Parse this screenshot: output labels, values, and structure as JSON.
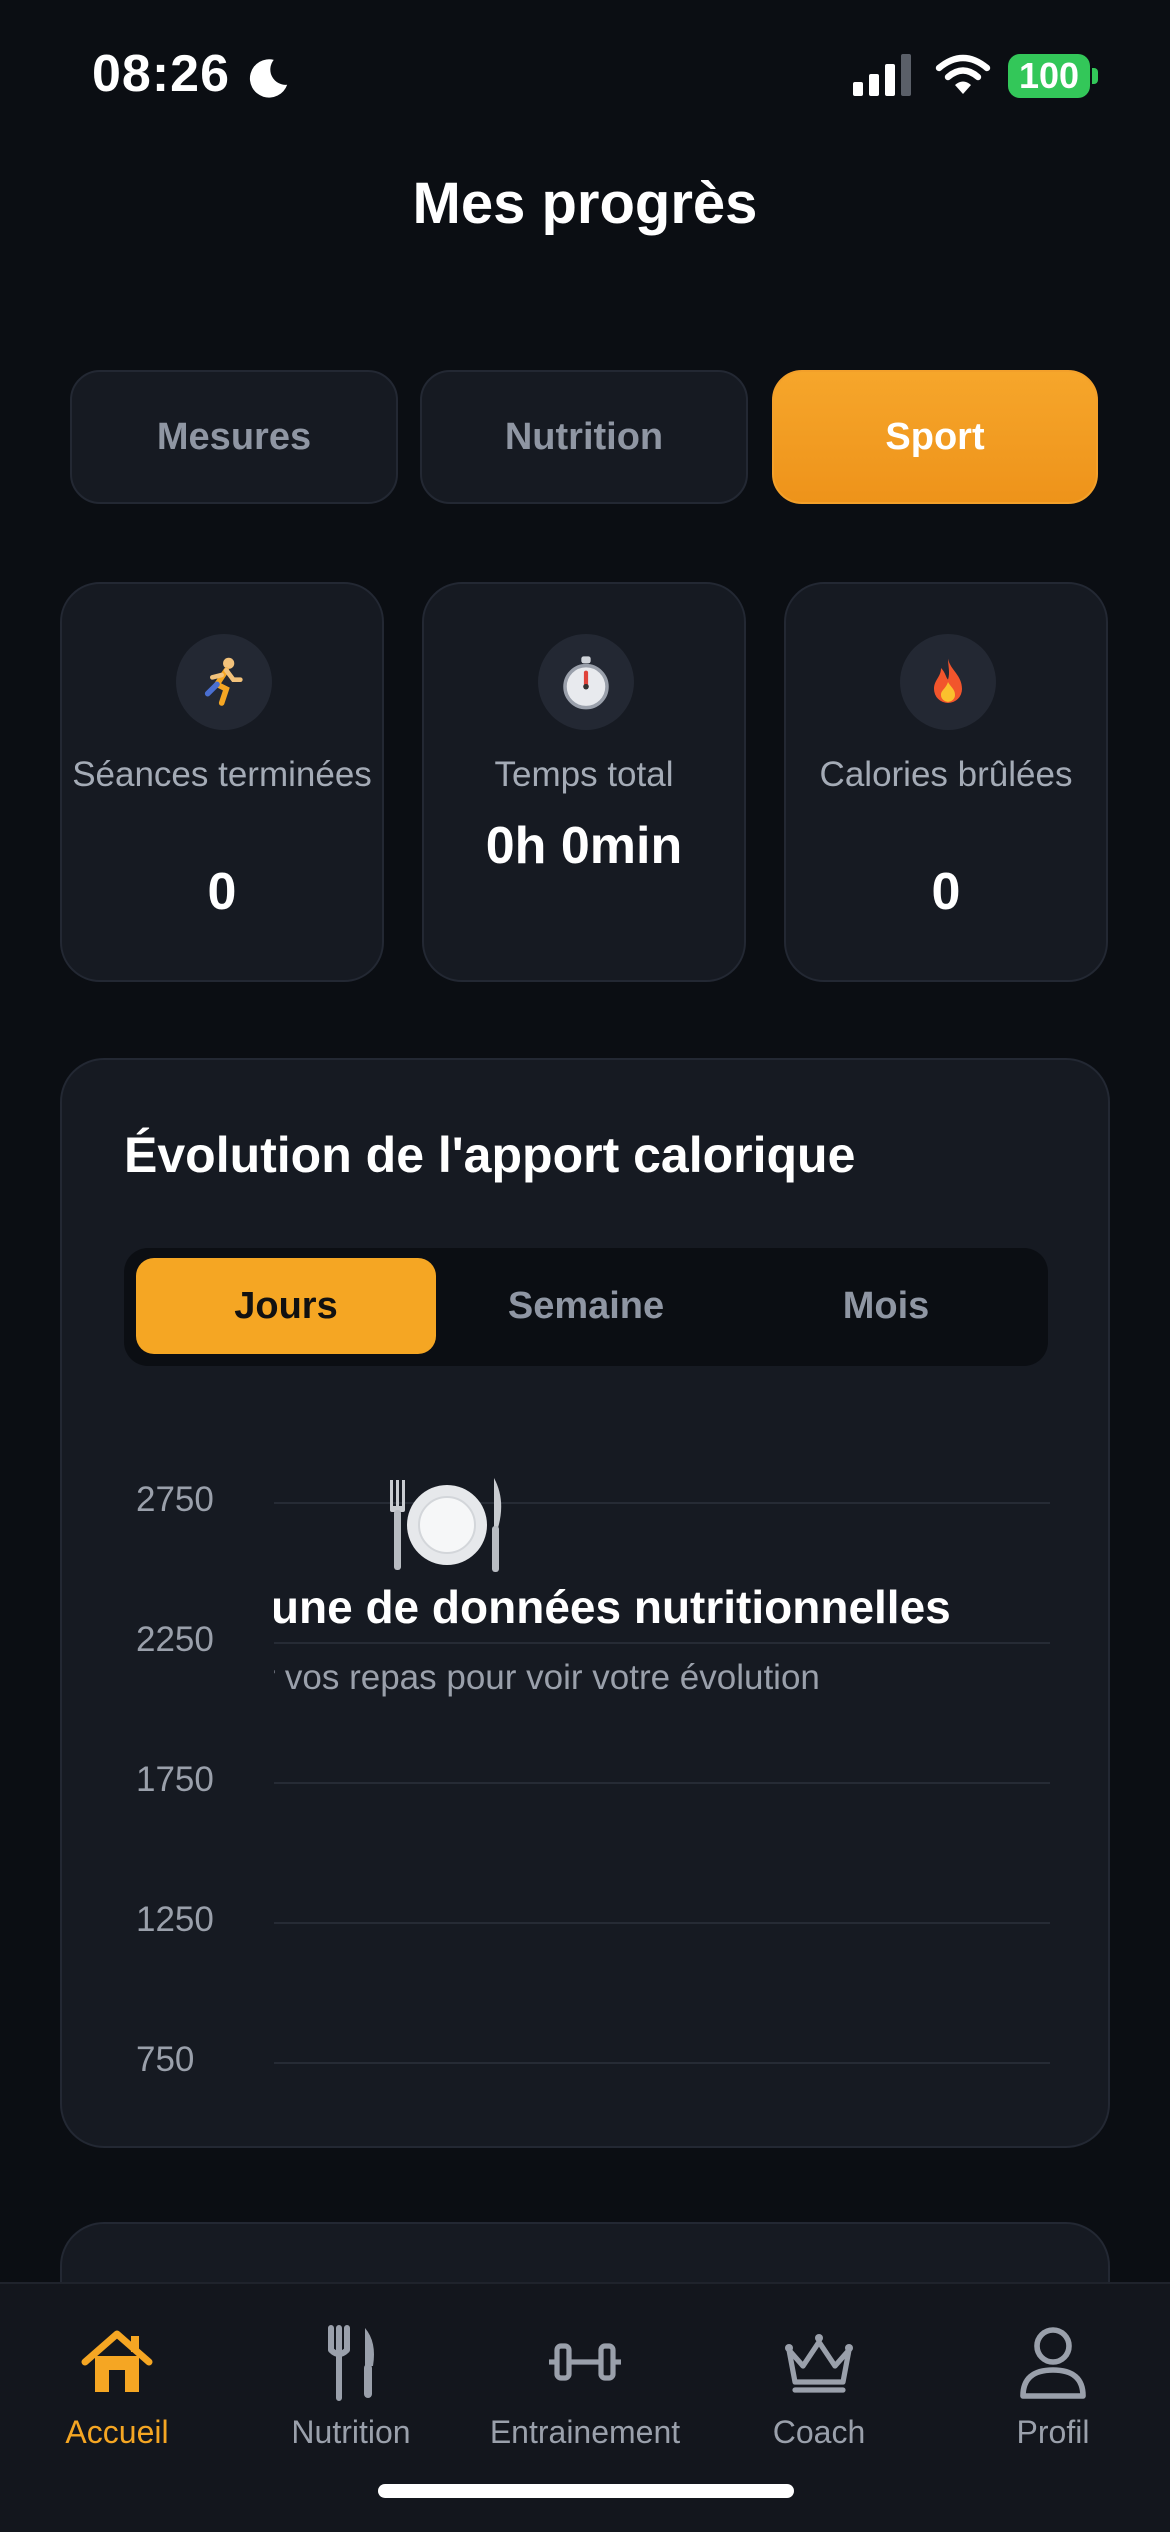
{
  "status": {
    "time": "08:26",
    "battery": "100"
  },
  "header": {
    "title": "Mes progrès"
  },
  "tabs": [
    {
      "label": "Mesures",
      "active": false
    },
    {
      "label": "Nutrition",
      "active": false
    },
    {
      "label": "Sport",
      "active": true
    }
  ],
  "stats": [
    {
      "label": "Séances terminées",
      "value": "0",
      "icon": "runner-icon"
    },
    {
      "label": "Temps total",
      "value": "0h 0min",
      "icon": "stopwatch-icon"
    },
    {
      "label": "Calories brûlées",
      "value": "0",
      "icon": "fire-icon"
    }
  ],
  "chart": {
    "title": "Évolution de l'apport calorique",
    "periods": [
      {
        "label": "Jours",
        "active": true
      },
      {
        "label": "Semaine",
        "active": false
      },
      {
        "label": "Mois",
        "active": false
      }
    ],
    "empty_title": "Aucune de données nutritionnelles",
    "empty_subtitle": "Enregistrer vos repas pour voir votre évolution",
    "empty_icon": "plate-cutlery-icon"
  },
  "chart_data": {
    "type": "line",
    "title": "Évolution de l'apport calorique",
    "xlabel": "",
    "ylabel": "",
    "y_ticks": [
      2750,
      2250,
      1750,
      1250,
      750
    ],
    "ylim": [
      750,
      2750
    ],
    "grid": true,
    "series": []
  },
  "nav": [
    {
      "label": "Accueil",
      "icon": "home-icon",
      "active": true
    },
    {
      "label": "Nutrition",
      "icon": "fork-knife-icon",
      "active": false
    },
    {
      "label": "Entrainement",
      "icon": "dumbbell-icon",
      "active": false
    },
    {
      "label": "Coach",
      "icon": "crown-icon",
      "active": false
    },
    {
      "label": "Profil",
      "icon": "person-icon",
      "active": false
    }
  ],
  "colors": {
    "accent": "#f5a623",
    "background": "#0b0e13",
    "card": "#161a22",
    "battery": "#33c759"
  }
}
